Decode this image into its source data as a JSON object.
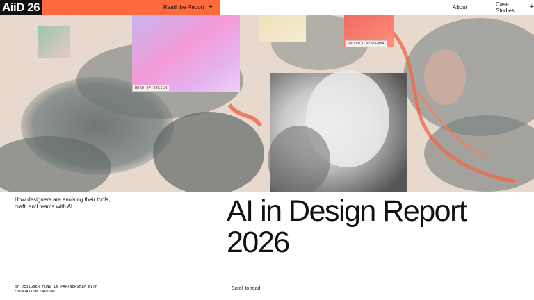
{
  "header": {
    "logo": "AiiD 26",
    "cta_label": "Read the Report",
    "cta_icon": "plus-icon",
    "nav": [
      {
        "label": "About"
      },
      {
        "label": "Case Studies",
        "icon": "plus-icon"
      }
    ]
  },
  "hero": {
    "cards": [
      {
        "label": "HEAD OF DESIGN"
      },
      {
        "label": "PRODUCT DESIGNER"
      }
    ]
  },
  "intro": {
    "tagline": "How designers are evolving their tools, craft, and teams with AI",
    "title_line1": "AI in Design Report",
    "title_line2": "2026"
  },
  "footer": {
    "credit": "BY DESIGNER FUND IN PARTNERSHIP WITH FOUNDATION CAPITAL",
    "scroll_label": "Scroll to read",
    "scroll_icon": "arrow-down-icon"
  },
  "colors": {
    "accent": "#ff6a3d",
    "logo_bg": "#111111",
    "hero_bg": "#e8d9cf"
  }
}
